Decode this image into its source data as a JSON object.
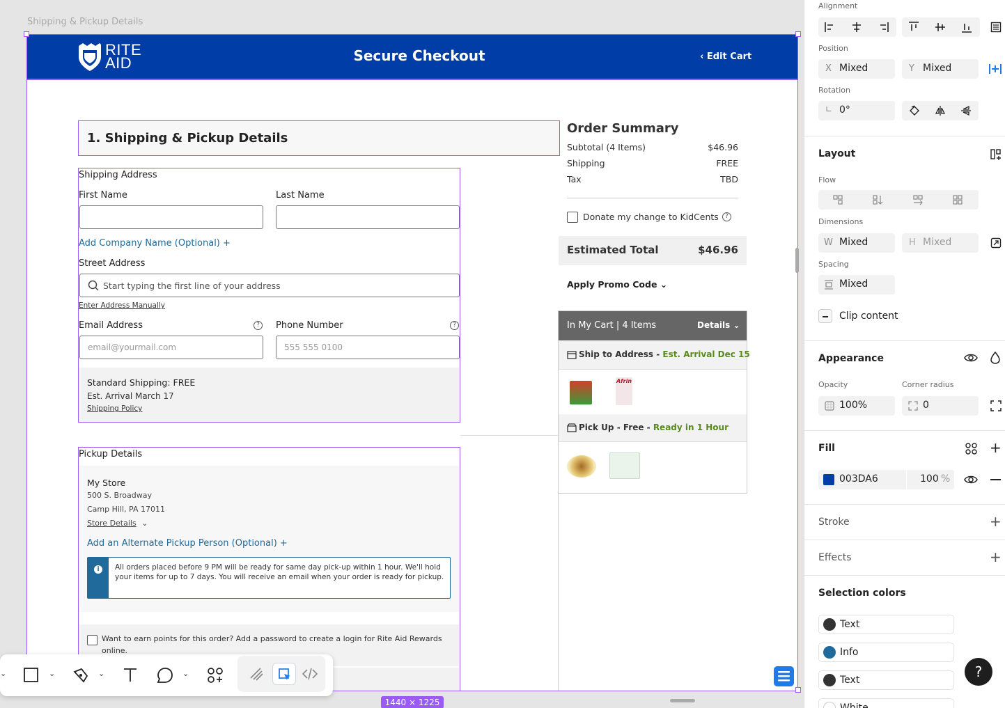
{
  "canvas": {
    "frame_label": "Shipping & Pickup Details",
    "size_badge": "1440 × 1225"
  },
  "header": {
    "logo_line1": "RITE",
    "logo_line2": "AID",
    "title": "Secure Checkout",
    "edit_cart": "Edit Cart",
    "brand_color": "#003DA6"
  },
  "shipping": {
    "section_title": "1. Shipping & Pickup Details",
    "address_heading": "Shipping Address",
    "first_name_label": "First Name",
    "last_name_label": "Last Name",
    "add_company": "Add Company Name (Optional) +",
    "street_label": "Street Address",
    "street_placeholder": "Start typing the first line of your address",
    "enter_manually": "Enter Address Manually",
    "email_label": "Email Address",
    "email_placeholder": "email@yourmail.com",
    "phone_label": "Phone Number",
    "phone_placeholder": "555 555 0100",
    "standard_shipping": "Standard Shipping: FREE",
    "est_arrival": "Est. Arrival March 17",
    "shipping_policy": "Shipping Policy"
  },
  "pickup": {
    "heading": "Pickup Details",
    "store_name": "My Store",
    "street": "500 S. Broadway",
    "city": "Camp Hill, PA 17011",
    "store_details": "Store Details",
    "alternate": "Add an Alternate Pickup Person (Optional) +",
    "info_text": "All orders placed before 9 PM will be ready for same day pick-up within 1 hour.  We'll hold your items for up to 7 days. You will receive an email when your order is ready for pickup.",
    "rewards_text": "Want to earn points for this order? Add a password to create a login for Rite Aid Rewards online."
  },
  "summary": {
    "title": "Order Summary",
    "rows": [
      {
        "label": "Subtotal (4 Items)",
        "value": "$46.96"
      },
      {
        "label": "Shipping",
        "value": "FREE"
      },
      {
        "label": "Tax",
        "value": "TBD"
      }
    ],
    "donate": "Donate my change to KidCents",
    "estimated_label": "Estimated Total",
    "estimated_value": "$46.96",
    "promo": "Apply Promo Code",
    "cart_label": "In My Cart | 4 Items",
    "details": "Details",
    "ship_to": "Ship to Address - ",
    "ship_arrival": "Est. Arrival Dec 15",
    "pickup_label": "Pick Up - Free - ",
    "pickup_ready": "Ready in 1 Hour",
    "product_brand": "Afrin",
    "accent_green": "#5a8a1e"
  },
  "panel": {
    "alignment": "Alignment",
    "position": "Position",
    "x_label": "X",
    "x_value": "Mixed",
    "y_label": "Y",
    "y_value": "Mixed",
    "rotation": "Rotation",
    "rotation_value": "0°",
    "layout": "Layout",
    "flow": "Flow",
    "dimensions": "Dimensions",
    "w_label": "W",
    "w_value": "Mixed",
    "h_label": "H",
    "h_value": "Mixed",
    "spacing": "Spacing",
    "spacing_value": "Mixed",
    "clip_content": "Clip content",
    "appearance": "Appearance",
    "opacity": "Opacity",
    "opacity_value": "100%",
    "corner_radius": "Corner radius",
    "corner_value": "0",
    "fill": "Fill",
    "fill_hex": "003DA6",
    "fill_opacity": "100",
    "fill_percent": "%",
    "stroke": "Stroke",
    "effects": "Effects",
    "selection_colors": "Selection colors",
    "colors": [
      {
        "name": "Text",
        "hex": "#333333"
      },
      {
        "name": "Info",
        "hex": "#1f6a9b"
      },
      {
        "name": "Text",
        "hex": "#333333"
      },
      {
        "name": "White",
        "hex": "#ffffff"
      }
    ],
    "help": "?"
  }
}
